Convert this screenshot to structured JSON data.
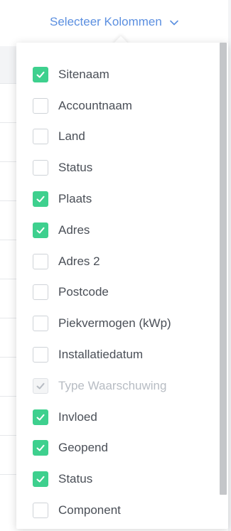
{
  "trigger": {
    "label": "Selecteer Kolommen",
    "icon": "chevron-down-icon",
    "color": "#5b8fe0"
  },
  "accent_color": "#3ed08e",
  "columns": [
    {
      "label": "Sitenaam",
      "checked": true,
      "disabled": false
    },
    {
      "label": "Accountnaam",
      "checked": false,
      "disabled": false
    },
    {
      "label": "Land",
      "checked": false,
      "disabled": false
    },
    {
      "label": "Status",
      "checked": false,
      "disabled": false
    },
    {
      "label": "Plaats",
      "checked": true,
      "disabled": false
    },
    {
      "label": "Adres",
      "checked": true,
      "disabled": false
    },
    {
      "label": "Adres 2",
      "checked": false,
      "disabled": false
    },
    {
      "label": "Postcode",
      "checked": false,
      "disabled": false
    },
    {
      "label": "Piekvermogen (kWp)",
      "checked": false,
      "disabled": false
    },
    {
      "label": "Installatiedatum",
      "checked": false,
      "disabled": false
    },
    {
      "label": "Type Waarschuwing",
      "checked": true,
      "disabled": true
    },
    {
      "label": "Invloed",
      "checked": true,
      "disabled": false
    },
    {
      "label": "Geopend",
      "checked": true,
      "disabled": false
    },
    {
      "label": "Status",
      "checked": true,
      "disabled": false
    },
    {
      "label": "Component",
      "checked": false,
      "disabled": false
    }
  ]
}
